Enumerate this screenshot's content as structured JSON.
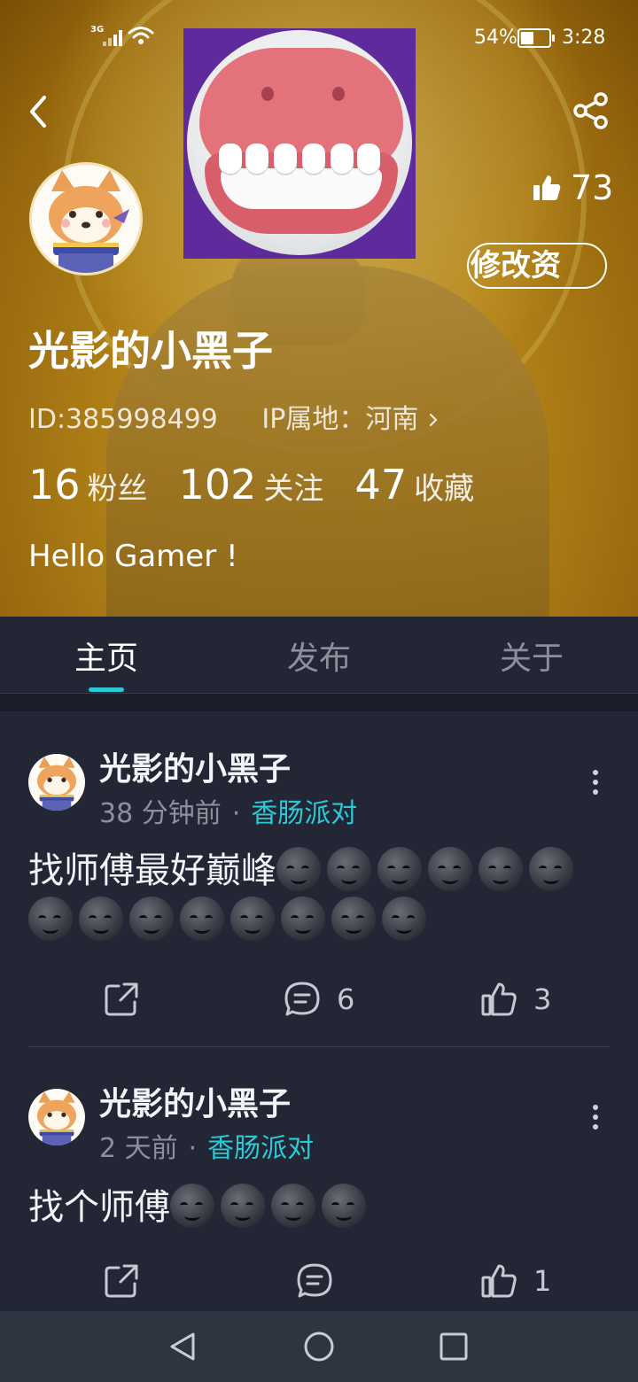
{
  "status_bar": {
    "network": "3G",
    "battery_percent": "54%",
    "battery_level": 0.54,
    "time": "3:28"
  },
  "profile": {
    "like_count": "73",
    "edit_button_label": "修改资",
    "name": "光影的小黑子",
    "id_text": "ID:385998499",
    "ip_text": "IP属地：河南",
    "stats": [
      {
        "num": "16",
        "label": "粉丝"
      },
      {
        "num": "102",
        "label": "关注"
      },
      {
        "num": "47",
        "label": "收藏"
      }
    ],
    "bio": "Hello Gamer !"
  },
  "tabs": [
    {
      "label": "主页",
      "active": true
    },
    {
      "label": "发布",
      "active": false
    },
    {
      "label": "关于",
      "active": false
    }
  ],
  "posts": [
    {
      "author": "光影的小黑子",
      "time": "38 分钟前",
      "separator": "·",
      "topic": "香肠派对",
      "text": "找师傅最好巅峰",
      "emoji_count": 14,
      "comment_count": "6",
      "like_count": "3"
    },
    {
      "author": "光影的小黑子",
      "time": "2 天前",
      "separator": "·",
      "topic": "香肠派对",
      "text": "找个师傅",
      "emoji_count": 4,
      "comment_count": "",
      "like_count": "1"
    }
  ],
  "icons": {
    "back": "chevron-left-icon",
    "share": "share-icon",
    "thumbs_up": "thumbs-up-icon",
    "repost": "share-external-icon",
    "comment": "comment-icon",
    "like": "like-icon",
    "more": "more-vertical-icon",
    "emoji": "smirk-emoji-icon",
    "nav_back": "triangle-back-icon",
    "nav_home": "circle-home-icon",
    "nav_recent": "square-recent-icon"
  },
  "colors": {
    "accent": "#2dc8d6",
    "feed_background": "#232735",
    "header_gold": "#d29a1c",
    "nav_bar": "#2f3441"
  }
}
